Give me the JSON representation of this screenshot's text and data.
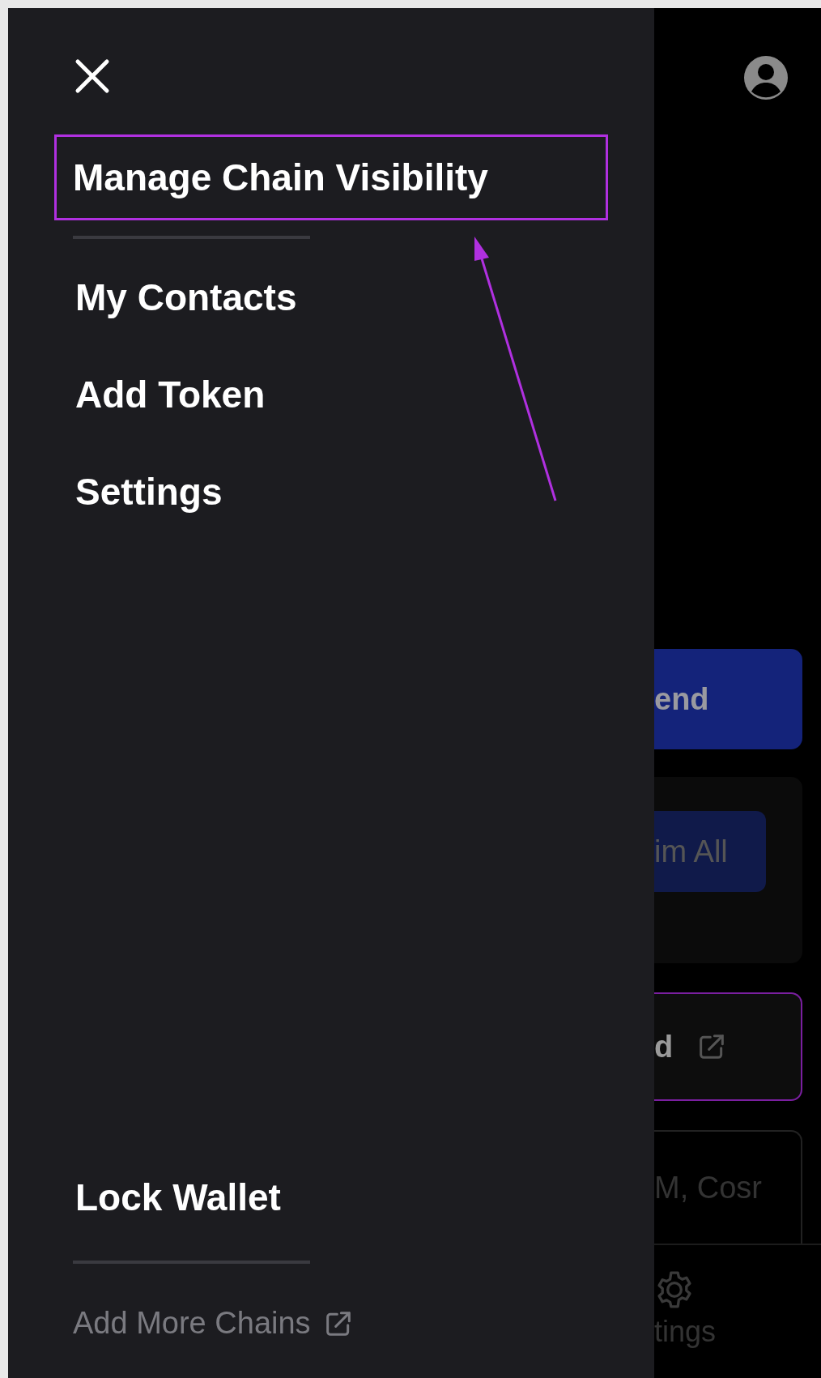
{
  "drawer": {
    "menu_items": [
      {
        "label": "Manage Chain Visibility",
        "highlighted": true
      },
      {
        "label": "My Contacts",
        "highlighted": false
      },
      {
        "label": "Add Token",
        "highlighted": false
      },
      {
        "label": "Settings",
        "highlighted": false
      }
    ],
    "lock_button": "Lock Wallet",
    "add_chains_link": "Add More Chains"
  },
  "background": {
    "send_button": "end",
    "claim_button": "im All",
    "link_button": "d",
    "search_placeholder": "M, Cosr",
    "nav_label": "tings"
  }
}
